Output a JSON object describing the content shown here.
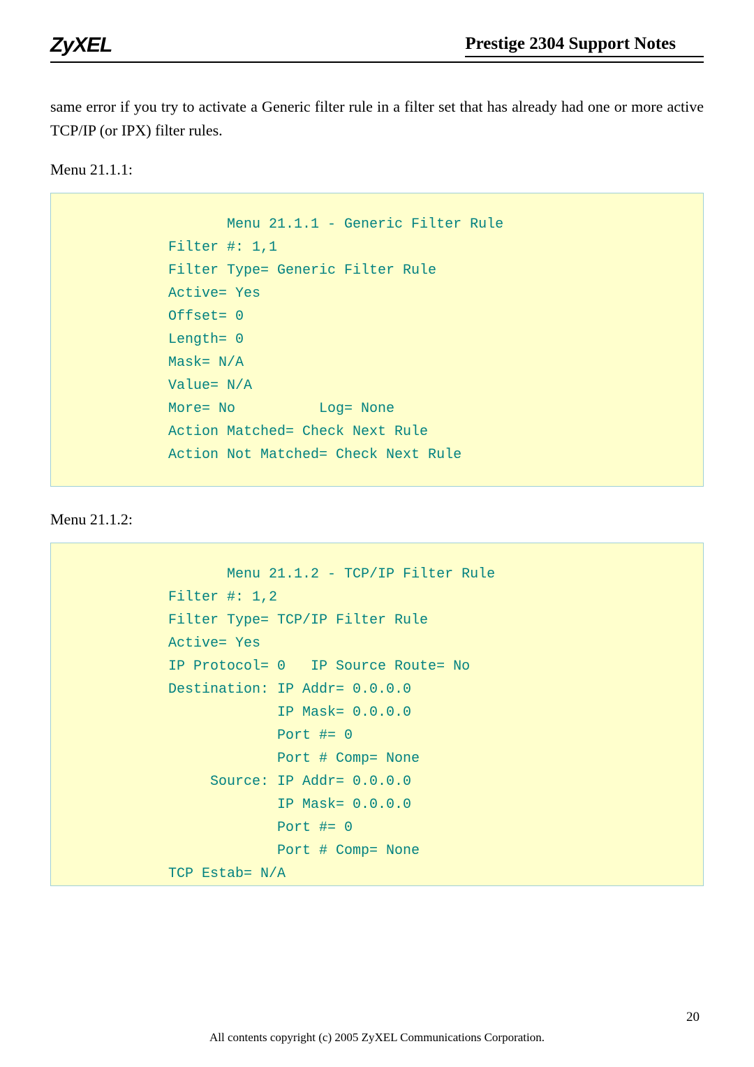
{
  "header": {
    "brand": "ZyXEL",
    "title": "Prestige 2304 Support Notes"
  },
  "paragraph": "same error if you try to activate a Generic filter rule in a filter set that has already had one or more active TCP/IP (or IPX) filter rules.",
  "label1": "Menu 21.1.1:",
  "code1": {
    "l0": "       Menu 21.1.1 - Generic Filter Rule",
    "l1": "Filter #: 1,1",
    "l2": "Filter Type= Generic Filter Rule",
    "l3": "Active= Yes",
    "l4": "Offset= 0",
    "l5": "Length= 0",
    "l6": "Mask= N/A",
    "l7": "Value= N/A",
    "l8": "More= No          Log= None",
    "l9": "Action Matched= Check Next Rule",
    "l10": "Action Not Matched= Check Next Rule"
  },
  "label2": "Menu 21.1.2:",
  "code2": {
    "l0": "       Menu 21.1.2 - TCP/IP Filter Rule",
    "l1": "Filter #: 1,2",
    "l2": "Filter Type= TCP/IP Filter Rule",
    "l3": "Active= Yes",
    "l4": "IP Protocol= 0   IP Source Route= No",
    "l5": "Destination: IP Addr= 0.0.0.0",
    "l6": "             IP Mask= 0.0.0.0",
    "l7": "             Port #= 0",
    "l8": "             Port # Comp= None",
    "l9": "     Source: IP Addr= 0.0.0.0",
    "l10": "             IP Mask= 0.0.0.0",
    "l11": "             Port #= 0",
    "l12": "             Port # Comp= None",
    "l13": "TCP Estab= N/A"
  },
  "page_number": "20",
  "footer": "All contents copyright (c) 2005 ZyXEL Communications Corporation."
}
